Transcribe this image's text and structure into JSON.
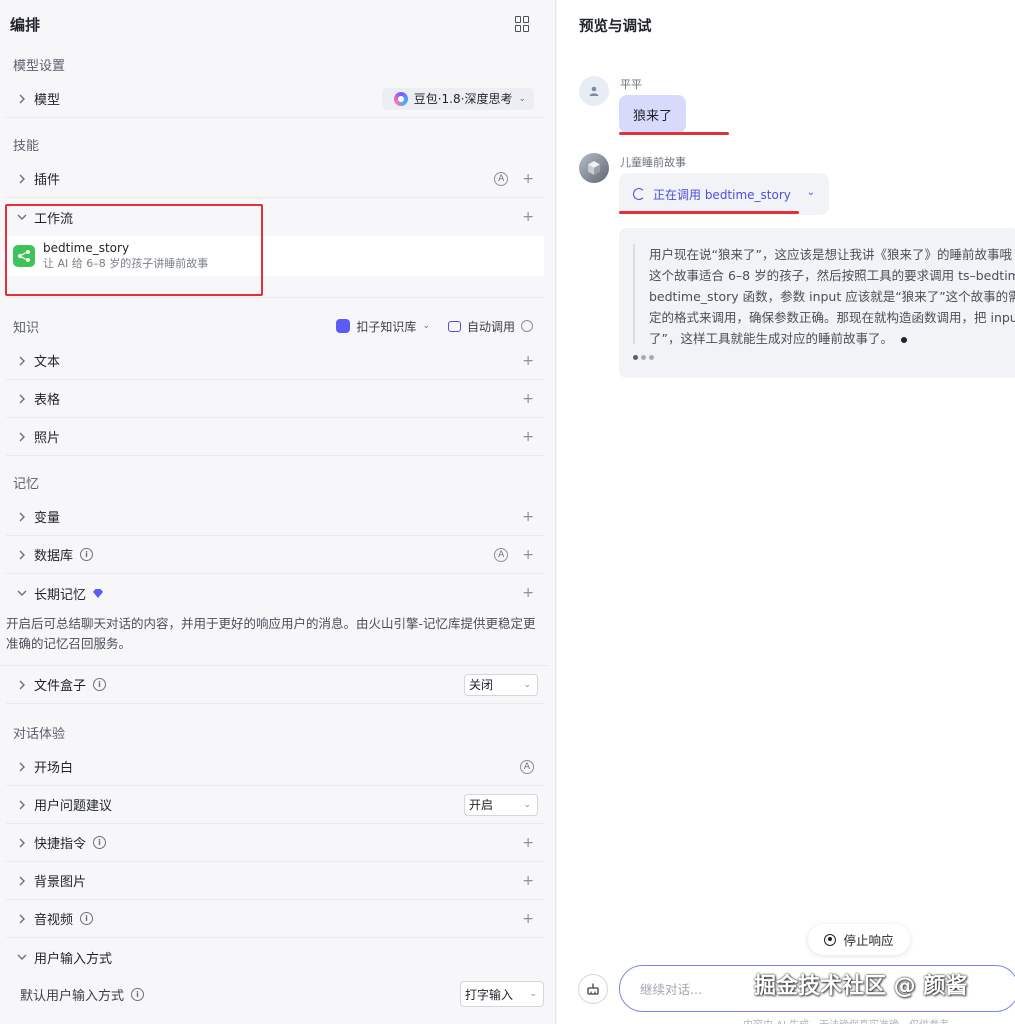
{
  "left": {
    "title": "编排",
    "sections": {
      "model_settings": "模型设置",
      "skills": "技能",
      "knowledge": "知识",
      "memory": "记忆",
      "dialog": "对话体验"
    },
    "model": {
      "label": "模型",
      "selected": "豆包·1.8·深度思考"
    },
    "plugin": {
      "label": "插件"
    },
    "workflow": {
      "label": "工作流",
      "item_name": "bedtime_story",
      "item_desc": "让 AI 给 6–8 岁的孩子讲睡前故事"
    },
    "knowledge_bar": {
      "kb_label": "扣子知识库",
      "auto_label": "自动调用"
    },
    "knowledge_items": [
      "文本",
      "表格",
      "照片"
    ],
    "variables": "变量",
    "database": "数据库",
    "long_memory": {
      "label": "长期记忆",
      "desc": "开启后可总结聊天对话的内容，并用于更好的响应用户的消息。由火山引擎-记忆库提供更稳定更准确的记忆召回服务。"
    },
    "file_box": {
      "label": "文件盒子",
      "value": "关闭"
    },
    "opening": "开场白",
    "suggestion": {
      "label": "用户问题建议",
      "value": "开启"
    },
    "shortcut": "快捷指令",
    "bg_image": "背景图片",
    "av": "音视频",
    "input_mode": {
      "label": "用户输入方式",
      "default_label": "默认用户输入方式",
      "value": "打字输入"
    }
  },
  "right": {
    "title": "预览与调试",
    "user_name": "平平",
    "user_message": "狼来了",
    "bot_name": "儿童睡前故事",
    "calling_text": "正在调用 bedtime_story",
    "thinking_lines": [
      "用户现在说“狼来了”，这应该是想让我讲《狼来了》的睡前故事哦",
      "这个故事适合 6–8 岁的孩子，然后按照工具的要求调用 ts–bedtim",
      "bedtime_story 函数，参数 input 应该就是“狼来了”这个故事的需求",
      "定的格式来调用，确保参数正确。那现在就构造函数调用，把 inpu",
      "了”，这样工具就能生成对应的睡前故事了。"
    ],
    "stop_label": "停止响应",
    "input_placeholder": "继续对话...",
    "watermark": "掘金技术社区 @ 颜酱",
    "footnote": "内容由 AI 生成，无法确保真实准确，仅供参考"
  },
  "colors": {
    "accent": "#4b4fd9",
    "highlight": "#e0323a",
    "user_bubble": "#d8dafc",
    "workflow_green": "#3ec25a"
  }
}
